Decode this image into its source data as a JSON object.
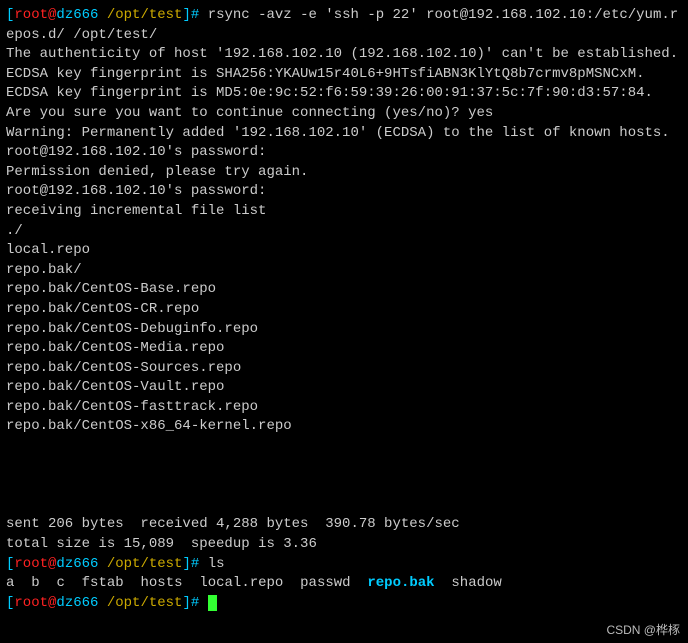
{
  "prompts": [
    {
      "user": "root",
      "host": "dz666",
      "path": "/opt/test",
      "command": "rsync -avz -e 'ssh -p 22' root@192.168.102.10:/etc/yum.repos.d/ /opt/test/"
    },
    {
      "user": "root",
      "host": "dz666",
      "path": "/opt/test",
      "command": "ls"
    },
    {
      "user": "root",
      "host": "dz666",
      "path": "/opt/test",
      "command": ""
    }
  ],
  "output": [
    "The authenticity of host '192.168.102.10 (192.168.102.10)' can't be established.",
    "ECDSA key fingerprint is SHA256:YKAUw15r40L6+9HTsfiABN3KlYtQ8b7crmv8pMSNCxM.",
    "ECDSA key fingerprint is MD5:0e:9c:52:f6:59:39:26:00:91:37:5c:7f:90:d3:57:84.",
    "Are you sure you want to continue connecting (yes/no)? yes",
    "Warning: Permanently added '192.168.102.10' (ECDSA) to the list of known hosts.",
    "root@192.168.102.10's password:",
    "Permission denied, please try again.",
    "root@192.168.102.10's password:",
    "receiving incremental file list",
    "./",
    "local.repo",
    "repo.bak/",
    "repo.bak/CentOS-Base.repo",
    "repo.bak/CentOS-CR.repo",
    "repo.bak/CentOS-Debuginfo.repo",
    "repo.bak/CentOS-Media.repo",
    "repo.bak/CentOS-Sources.repo",
    "repo.bak/CentOS-Vault.repo",
    "repo.bak/CentOS-fasttrack.repo",
    "repo.bak/CentOS-x86_64-kernel.repo",
    "",
    "",
    "",
    "sent 206 bytes  received 4,288 bytes  390.78 bytes/sec",
    "total size is 15,089  speedup is 3.36"
  ],
  "ls": [
    "a",
    "b",
    "c",
    "fstab",
    "hosts",
    "local.repo",
    "passwd",
    "repo.bak",
    "shadow"
  ],
  "watermark": "CSDN @桦㭬"
}
